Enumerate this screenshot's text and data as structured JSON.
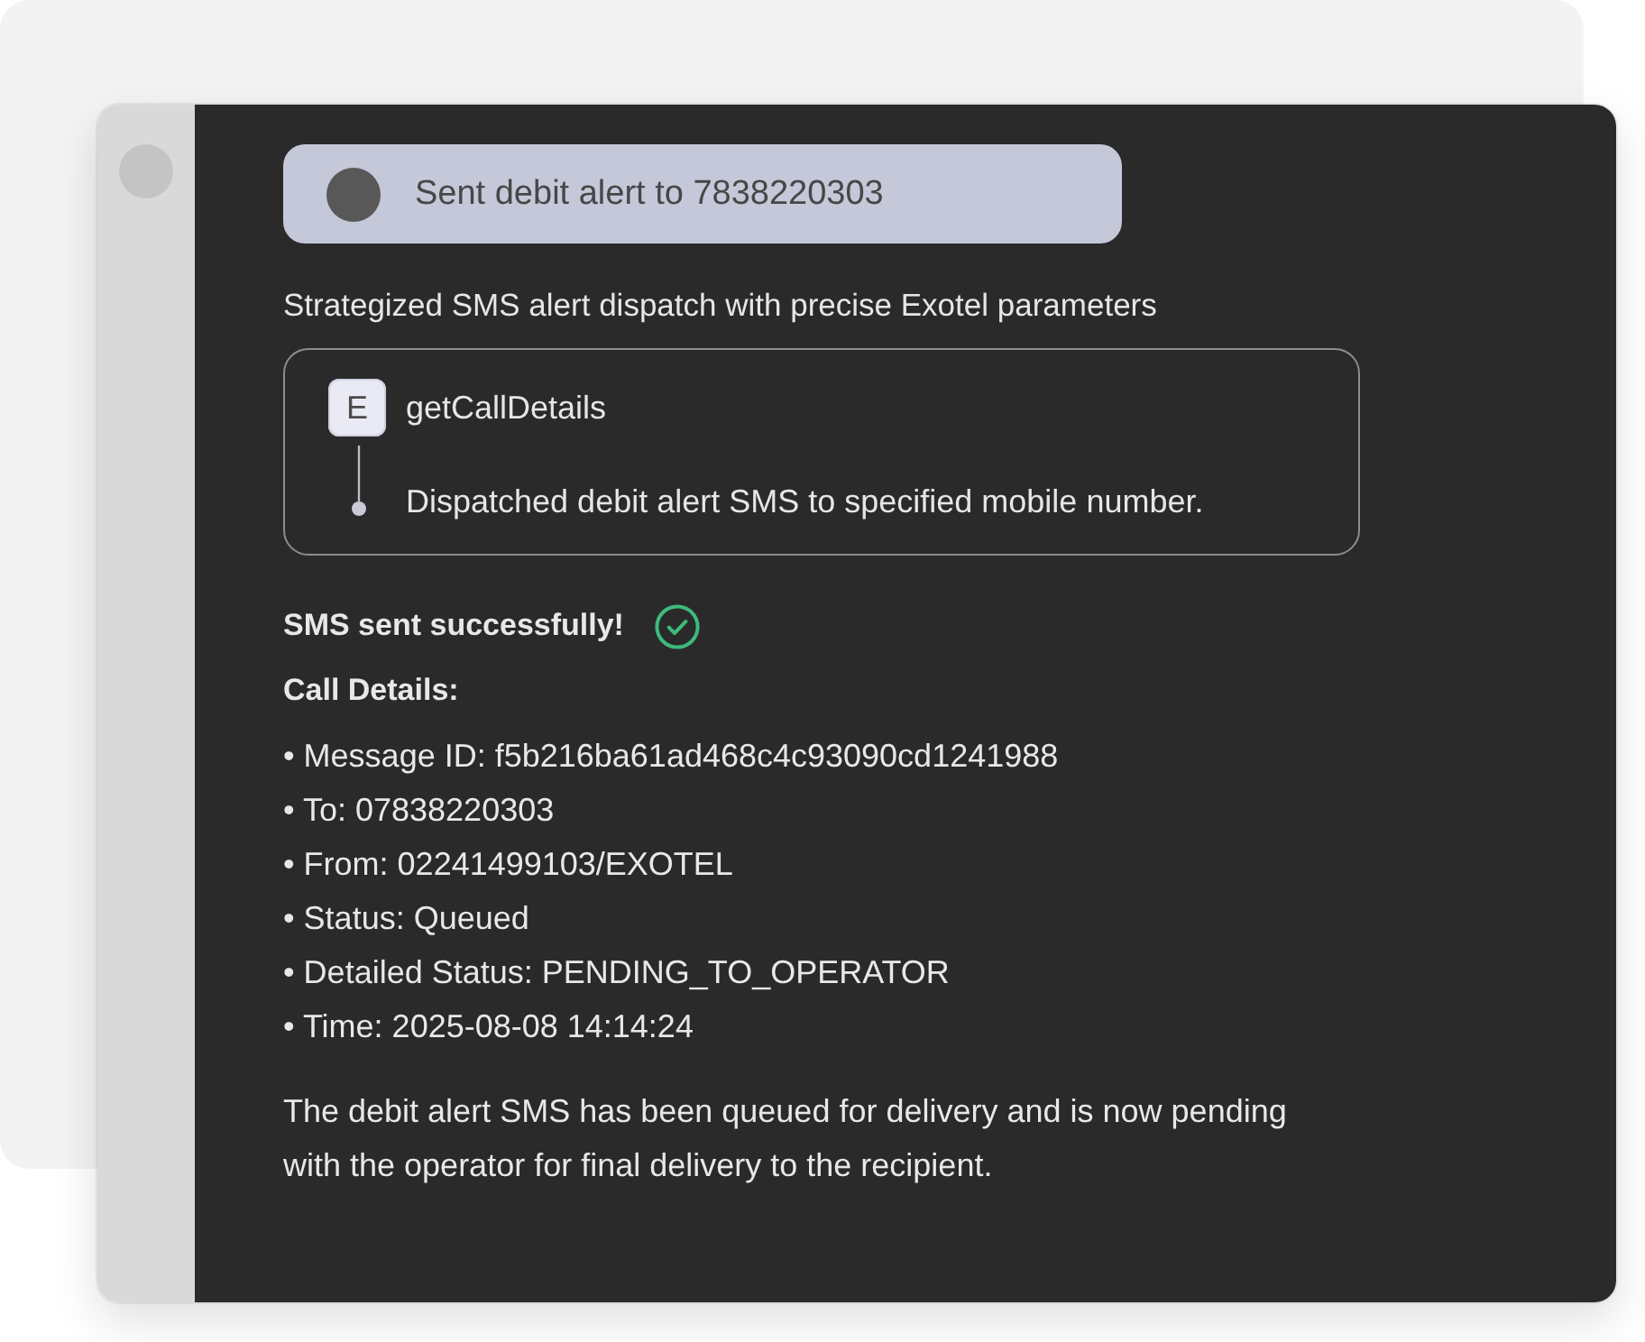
{
  "action_banner": {
    "text": "Sent debit alert to 7838220303"
  },
  "summary": "Strategized SMS alert dispatch with precise Exotel parameters",
  "tool_call": {
    "badge": "E",
    "name": "getCallDetails",
    "steps": [
      "Dispatched debit alert SMS to specified mobile number."
    ]
  },
  "result": {
    "title": "SMS sent successfully!",
    "details_heading": "Call Details:",
    "details": [
      "• Message ID: f5b216ba61ad468c4c93090cd1241988",
      "• To: 07838220303",
      "• From: 02241499103/EXOTEL",
      "• Status: Queued",
      "• Detailed Status: PENDING_TO_OPERATOR",
      "• Time: 2025-08-08 14:14:24"
    ],
    "closing": "The debit alert SMS has been queued for delivery and is now pending with the operator for final delivery to the recipient."
  }
}
